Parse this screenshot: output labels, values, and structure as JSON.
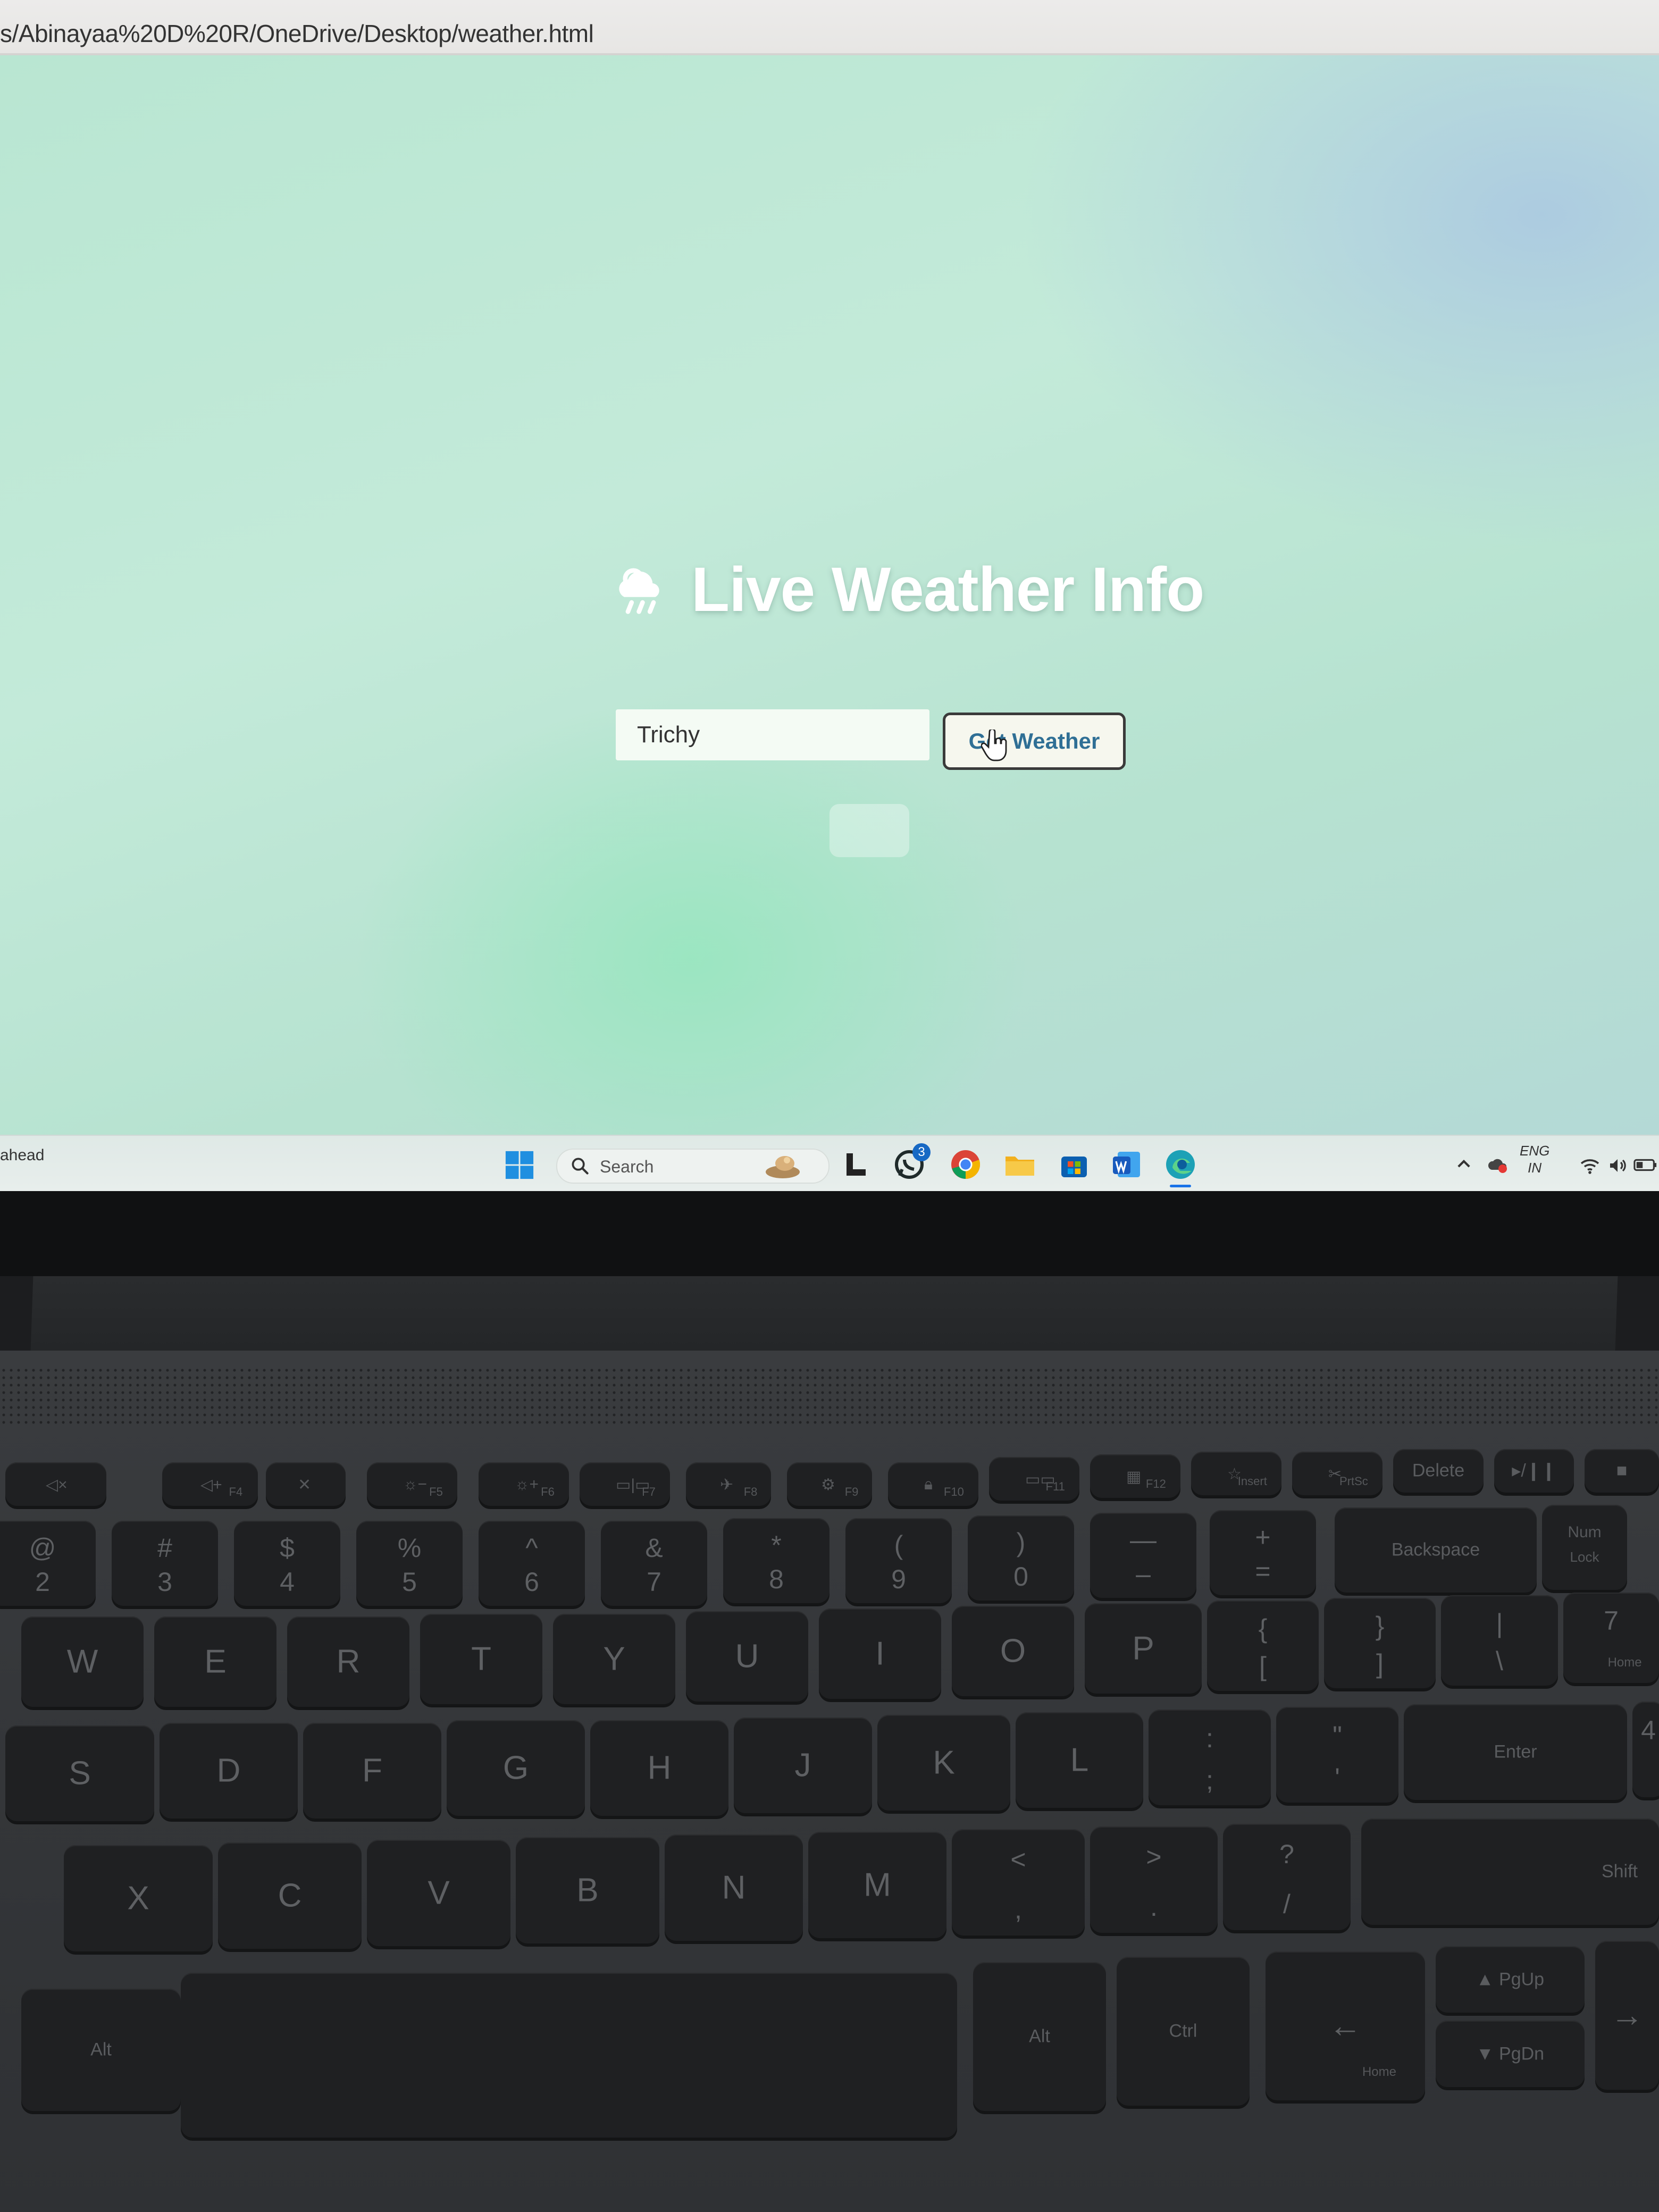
{
  "browser": {
    "url": "s/Abinayaa%20D%20R/OneDrive/Desktop/weather.html"
  },
  "weather_app": {
    "title": "Live Weather Info",
    "title_icon": "cloud-sun-rain-icon",
    "city_input_value": "Trichy",
    "button_label": "Get Weather"
  },
  "taskbar": {
    "left_text": "ahead",
    "search_label": "Search",
    "whatsapp_badge": "3",
    "apps": [
      "windows-start-icon",
      "search-icon",
      "widget-icon",
      "app-l-icon",
      "whatsapp-icon",
      "chrome-icon",
      "file-explorer-icon",
      "microsoft-store-icon",
      "word-icon",
      "edge-icon"
    ],
    "tray": {
      "lang_line1": "ENG",
      "lang_line2": "IN"
    }
  },
  "keyboard": {
    "fn_row": [
      {
        "label": "F4"
      },
      {
        "label": "F5"
      },
      {
        "label": "F6"
      },
      {
        "label": "F7"
      },
      {
        "label": "F8"
      },
      {
        "label": "F9"
      },
      {
        "label": "F10"
      },
      {
        "label": "F11"
      },
      {
        "label": "F12"
      },
      {
        "label": "Insert"
      },
      {
        "label": "PrtSc"
      },
      {
        "label": "Delete"
      }
    ],
    "number_row": [
      {
        "top": "@",
        "bottom": "2"
      },
      {
        "top": "#",
        "bottom": "3"
      },
      {
        "top": "$",
        "bottom": "4"
      },
      {
        "top": "%",
        "bottom": "5"
      },
      {
        "top": "^",
        "bottom": "6"
      },
      {
        "top": "&",
        "bottom": "7"
      },
      {
        "top": "*",
        "bottom": "8"
      },
      {
        "top": "(",
        "bottom": "9"
      },
      {
        "top": ")",
        "bottom": "0"
      },
      {
        "top": "—",
        "bottom": "–"
      },
      {
        "top": "+",
        "bottom": "="
      }
    ],
    "backspace": "Backspace",
    "num_lock_1": "Num",
    "num_lock_2": "Lock",
    "qwerty_row": [
      "W",
      "E",
      "R",
      "T",
      "Y",
      "U",
      "I",
      "O",
      "P"
    ],
    "bracket_open_top": "{",
    "bracket_open_bot": "[",
    "bracket_close_top": "}",
    "bracket_close_bot": "]",
    "pipe_top": "|",
    "pipe_bot": "\\",
    "num7": "7",
    "home_label": "Home",
    "home_row": [
      "S",
      "D",
      "F",
      "G",
      "H",
      "J",
      "K",
      "L"
    ],
    "colon_top": ":",
    "colon_bot": ";",
    "quote_top": "\"",
    "quote_bot": "'",
    "enter": "Enter",
    "num4": "4",
    "bottom_row": [
      "X",
      "C",
      "V",
      "B",
      "N",
      "M"
    ],
    "lt_top": "<",
    "lt_bot": ",",
    "gt_top": ">",
    "gt_bot": ".",
    "q_top": "?",
    "q_bot": "/",
    "shift": "Shift",
    "alt_left": "Alt",
    "alt": "Alt",
    "ctrl": "Ctrl",
    "home_small": "Home",
    "pgup": "PgUp",
    "pgdn": "PgDn"
  }
}
